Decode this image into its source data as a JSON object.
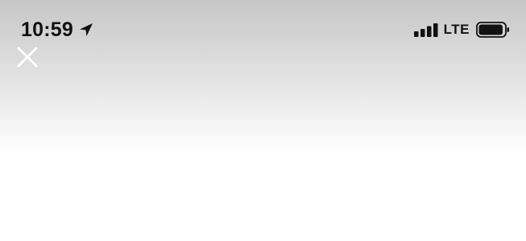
{
  "status_bar": {
    "time": "10:59",
    "network": "LTE",
    "icons": {
      "location": "location-arrow-icon",
      "signal": "cellular-signal-icon",
      "battery": "battery-icon"
    },
    "signal_bars_filled": 4,
    "battery_level": 0.95
  },
  "toolbar": {
    "close_icon": "close-icon"
  },
  "colors": {
    "status_text": "#111111",
    "close_icon": "#ffffff",
    "background_top": "#c7c7c7",
    "background_bottom": "#ffffff"
  }
}
